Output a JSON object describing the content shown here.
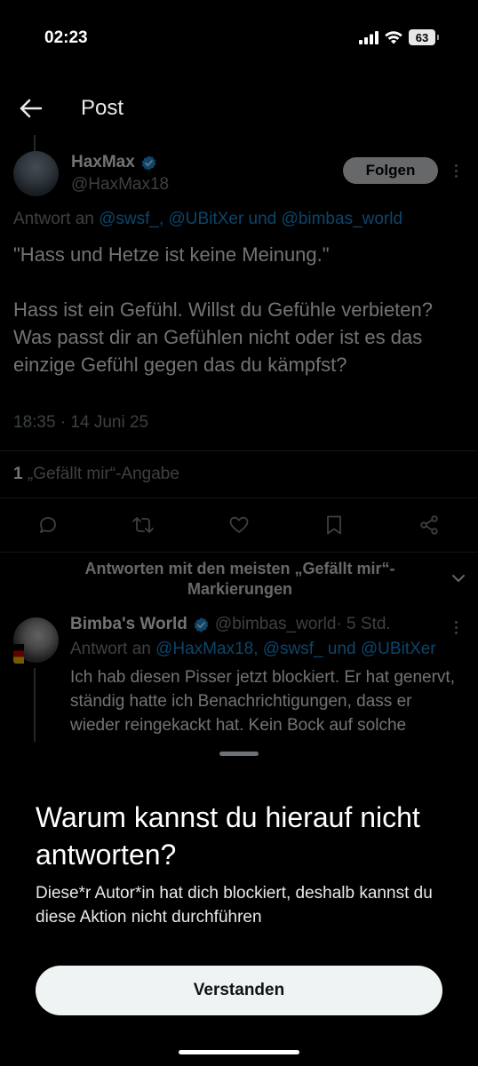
{
  "status_bar": {
    "time": "02:23",
    "battery": "63",
    "icons": [
      "signal-icon",
      "wifi-icon",
      "battery-icon"
    ]
  },
  "header": {
    "title": "Post",
    "back_icon": "arrow-left-icon"
  },
  "post": {
    "author_name": "HaxMax",
    "author_handle": "@HaxMax18",
    "follow_label": "Folgen",
    "reply_prefix": "Antwort an ",
    "reply_mentions": "@swsf_, @UBitXer und @bimbas_world",
    "text_paragraphs": [
      "\"Hass und Hetze ist keine Meinung.\"",
      "Hass ist ein Gefühl. Willst du Gefühle verbieten? Was passt dir an Gefühlen nicht oder ist es das einzige Gefühl gegen das du kämpfst?"
    ],
    "timestamp": "18:35 · 14 Juni 25",
    "likes_count": "1",
    "likes_label": " „Gefällt mir“-Angabe",
    "actions": [
      "reply-icon",
      "repost-icon",
      "like-icon",
      "bookmark-icon",
      "share-icon"
    ]
  },
  "replies_section": {
    "sort_label": "Antworten mit den meisten „Gefällt mir“-Markierungen"
  },
  "reply": {
    "author_name": "Bimba's World",
    "author_handle": "@bimbas_world",
    "time": " · 5 Std.",
    "reply_prefix": "Antwort an ",
    "reply_mentions": "@HaxMax18, @swsf_ und @UBitXer",
    "text": "Ich hab diesen Pisser jetzt blockiert. Er hat genervt, ständig hatte ich Benachrichtigungen, dass er wieder reingekackt hat. Kein Bock auf solche hasserfüllten Linksspacken"
  },
  "sheet": {
    "title": "Warum kannst du hierauf nicht antworten?",
    "body": "Diese*r Autor*in hat dich blockiert, deshalb kannst du diese Aktion nicht durchführen",
    "button_label": "Verstanden"
  },
  "colors": {
    "background": "#000000",
    "accent_blue": "#1d9bf0",
    "muted_text": "#8a8f94",
    "button_bg": "#eff3f4"
  }
}
